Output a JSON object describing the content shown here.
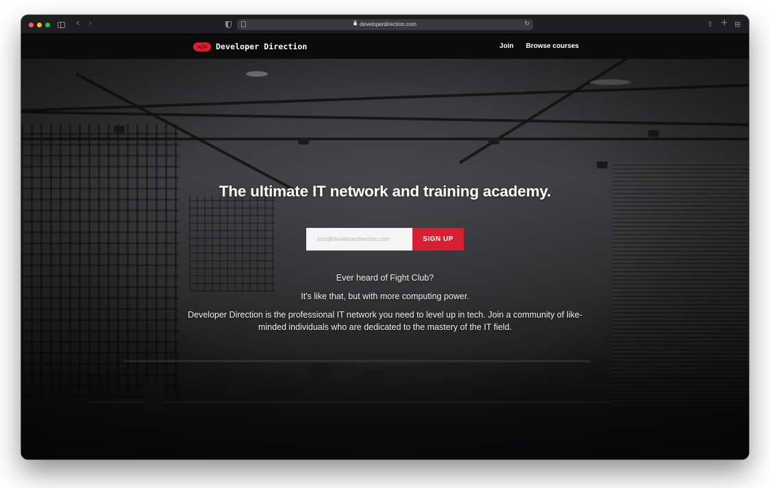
{
  "browser": {
    "url": "developerdirection.com",
    "back_icon": "‹",
    "forward_icon": "›",
    "reload_icon": "↻",
    "share_icon": "⇧",
    "new_tab_icon": "+",
    "tabs_icon": "⊞"
  },
  "header": {
    "logo_mark": "</>",
    "logo_text": "Developer Direction",
    "nav": {
      "join": "Join",
      "browse": "Browse courses"
    }
  },
  "hero": {
    "headline": "The ultimate IT network and training academy.",
    "email_placeholder": "josh@developerdirection.com",
    "signup_label": "SIGN UP",
    "tagline_1": "Ever heard of Fight Club?",
    "tagline_2": "It's like that, but with more computing power.",
    "description": "Developer Direction is the professional IT network you need to level up in tech. Join a community of like-minded individuals who are dedicated to the mastery of the IT field."
  },
  "colors": {
    "brand_red": "#d71f33",
    "header_bg": "#0b0b0c",
    "toolbar_bg": "#1e1e20"
  }
}
